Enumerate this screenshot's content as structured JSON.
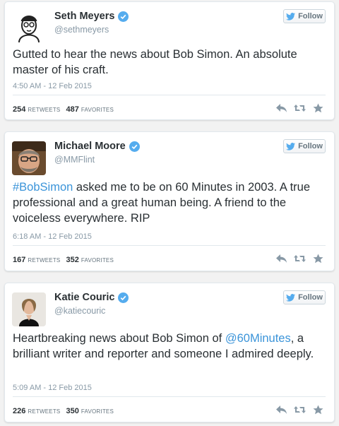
{
  "accent_color": "#3b94d9",
  "verified_color": "#55acee",
  "tweets": [
    {
      "name": "Seth Meyers",
      "handle": "@sethmeyers",
      "follow_label": "Follow",
      "text": "Gutted to hear the news about Bob Simon.  An absolute master of his craft.",
      "timestamp": "4:50 AM - 12 Feb 2015",
      "retweets": "254",
      "retweets_label": "RETWEETS",
      "favorites": "487",
      "favorites_label": "FAVORITES"
    },
    {
      "name": "Michael Moore",
      "handle": "@MMFlint",
      "follow_label": "Follow",
      "hashtag": "#BobSimon",
      "text": " asked me to be on 60 Minutes in 2003. A true professional and a great human being. A friend to the voiceless everywhere. RIP",
      "timestamp": "6:18 AM - 12 Feb 2015",
      "retweets": "167",
      "retweets_label": "RETWEETS",
      "favorites": "352",
      "favorites_label": "FAVORITES"
    },
    {
      "name": "Katie Couric",
      "handle": "@katiecouric",
      "follow_label": "Follow",
      "text_before": "Heartbreaking news about Bob Simon of ",
      "mention": "@60Minutes",
      "text_after": ", a brilliant writer and reporter and someone I admired deeply.",
      "timestamp": "5:09 AM - 12 Feb 2015",
      "retweets": "226",
      "retweets_label": "RETWEETS",
      "favorites": "350",
      "favorites_label": "FAVORITES"
    }
  ]
}
